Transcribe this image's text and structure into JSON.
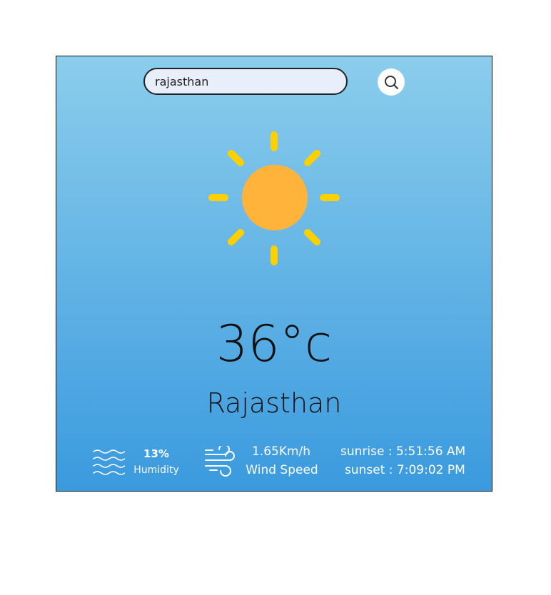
{
  "search": {
    "value": "rajasthan",
    "icon": "search-icon"
  },
  "weather": {
    "icon": "sun-icon",
    "temperature": "36°c",
    "city": "Rajasthan"
  },
  "stats": {
    "humidity_value": "13%",
    "humidity_label": "Humidity",
    "humidity_icon": "humidity-waves-icon",
    "wind_value": "1.65Km/h",
    "wind_label": "Wind Speed",
    "wind_icon": "wind-icon",
    "sunrise": "sunrise : 5:51:56 AM",
    "sunset": "sunset : 7:09:02 PM"
  },
  "colors": {
    "gradient_top": "#8bcdec",
    "gradient_bottom": "#3a9ade",
    "sun_body": "#ffb33a",
    "sun_shade": "#ff9f1c",
    "sun_rays": "#ffd000"
  }
}
